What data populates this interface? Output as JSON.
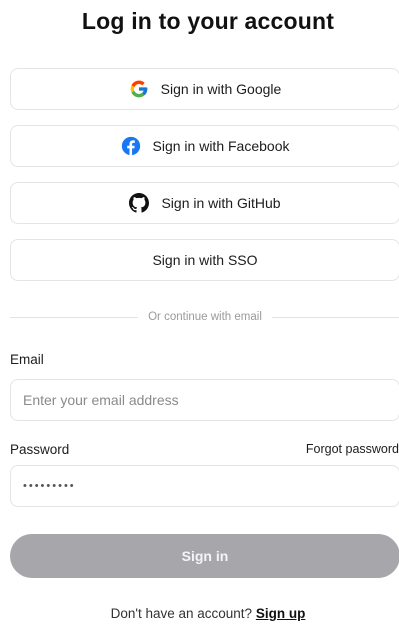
{
  "header": {
    "title": "Log in to your account"
  },
  "providers": [
    {
      "label": "Sign in with Google",
      "icon": "google-icon"
    },
    {
      "label": "Sign in with Facebook",
      "icon": "facebook-icon",
      "color": "#1877F2"
    },
    {
      "label": "Sign in with GitHub",
      "icon": "github-icon",
      "color": "#111111"
    },
    {
      "label": "Sign in with SSO"
    }
  ],
  "divider": {
    "text": "Or continue with email"
  },
  "form": {
    "email": {
      "label": "Email",
      "placeholder": "Enter your email address",
      "value": ""
    },
    "password": {
      "label": "Password",
      "value": "•••••••••",
      "forgot_label": "Forgot password"
    },
    "submit_label": "Sign in"
  },
  "footer": {
    "prompt": "Don't have an account?",
    "link_label": "Sign up"
  },
  "colors": {
    "submit_bg": "#A6A6AB",
    "border": "#E4E4E4"
  }
}
